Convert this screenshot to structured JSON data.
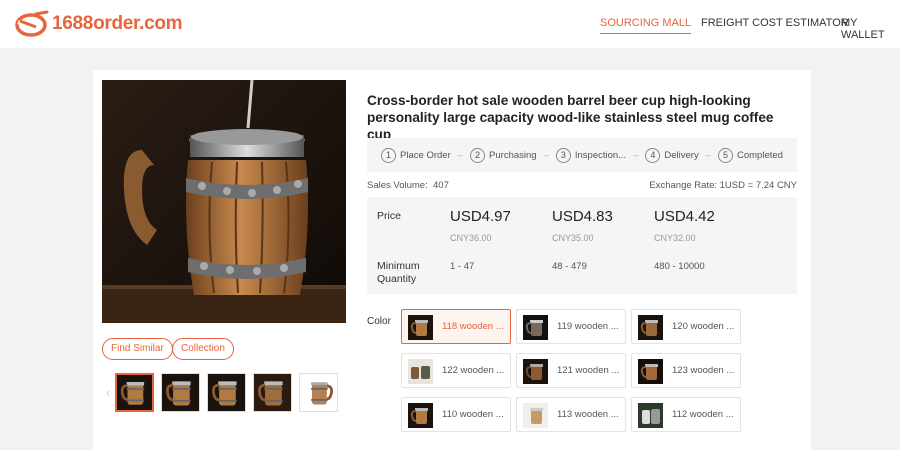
{
  "brand": {
    "name": "1688order.com",
    "color": "#e8643c"
  },
  "nav": [
    {
      "label": "SOURCING MALL",
      "active": true
    },
    {
      "label": "FREIGHT COST ESTIMATOR",
      "active": false
    },
    {
      "label": "MY WALLET",
      "active": false
    }
  ],
  "product": {
    "title": "Cross-border hot sale wooden barrel beer cup high-looking personality large capacity wood-like stainless steel mug coffee cup",
    "buttons": {
      "find_similar": "Find Similar",
      "collection": "Collection"
    },
    "steps": [
      {
        "num": "1",
        "label": "Place Order"
      },
      {
        "num": "2",
        "label": "Purchasing"
      },
      {
        "num": "3",
        "label": "Inspection..."
      },
      {
        "num": "4",
        "label": "Delivery"
      },
      {
        "num": "5",
        "label": "Completed"
      }
    ],
    "step_separator": "–",
    "sales_label": "Sales Volume:",
    "sales_value": "407",
    "exchange_rate": "Exchange Rate: 1USD = 7.24 CNY",
    "price_label": "Price",
    "min_qty_label_1": "Minimum",
    "min_qty_label_2": "Quantity",
    "tiers": [
      {
        "usd": "USD4.97",
        "cny": "CNY36.00",
        "range": "1 - 47"
      },
      {
        "usd": "USD4.83",
        "cny": "CNY35.00",
        "range": "48 - 479"
      },
      {
        "usd": "USD4.42",
        "cny": "CNY32.00",
        "range": "480 - 10000"
      }
    ],
    "color_label": "Color",
    "colors": [
      {
        "label": "118 wooden ...",
        "selected": true
      },
      {
        "label": "119 wooden ...",
        "selected": false
      },
      {
        "label": "120 wooden ...",
        "selected": false
      },
      {
        "label": "122 wooden ...",
        "selected": false
      },
      {
        "label": "121 wooden ...",
        "selected": false
      },
      {
        "label": "123 wooden ...",
        "selected": false
      },
      {
        "label": "110 wooden ...",
        "selected": false
      },
      {
        "label": "113 wooden ...",
        "selected": false
      },
      {
        "label": "112 wooden ...",
        "selected": false
      }
    ]
  }
}
